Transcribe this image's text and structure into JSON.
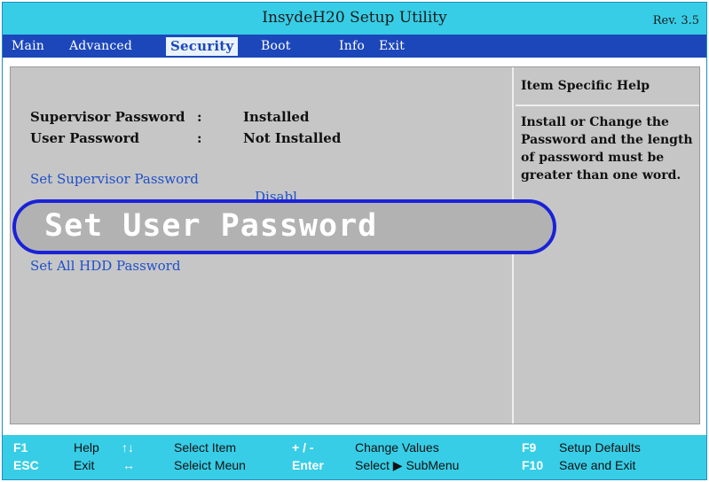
{
  "header": {
    "title": "InsydeH20 Setup Utility",
    "revision": "Rev. 3.5"
  },
  "menu": {
    "items": [
      {
        "label": "Main"
      },
      {
        "label": "Advanced"
      },
      {
        "label": "Security",
        "active": true
      },
      {
        "label": "Boot"
      },
      {
        "label": "Info"
      },
      {
        "label": "Exit"
      }
    ]
  },
  "security": {
    "supervisor_password_label": "Supervisor Password",
    "supervisor_password_value": "Installed",
    "user_password_label": "User Password",
    "user_password_value": "Not Installed",
    "separator": ":",
    "links": {
      "set_supervisor_password": "Set Supervisor Password",
      "set_user_password": "Set User Password",
      "set_all_hdd_password": "Set All HDD Password"
    },
    "partial_hidden_value": "Disabl"
  },
  "help": {
    "title": "Item Specific Help",
    "text": "Install or Change the Password and the length of password must be greater than one word."
  },
  "footer": {
    "row1": [
      {
        "key": "F1",
        "desc": "Help"
      },
      {
        "key": "↑↓",
        "desc": "Select Item"
      },
      {
        "key": "+ / -",
        "desc": "Change Values"
      },
      {
        "key": "F9",
        "desc": "Setup Defaults"
      }
    ],
    "row2": [
      {
        "key": "ESC",
        "desc": "Exit"
      },
      {
        "key": "↔",
        "desc": "Seleict Meun"
      },
      {
        "key": "Enter",
        "desc": "Select ▶ SubMenu"
      },
      {
        "key": "F10",
        "desc": "Save and Exit"
      }
    ]
  },
  "colors": {
    "title_bar": "#38cde6",
    "menu_bar": "#1c47bb",
    "content_bg": "#c6c6c6",
    "highlight_border": "#1a22d8",
    "link": "#1f4fc8"
  }
}
